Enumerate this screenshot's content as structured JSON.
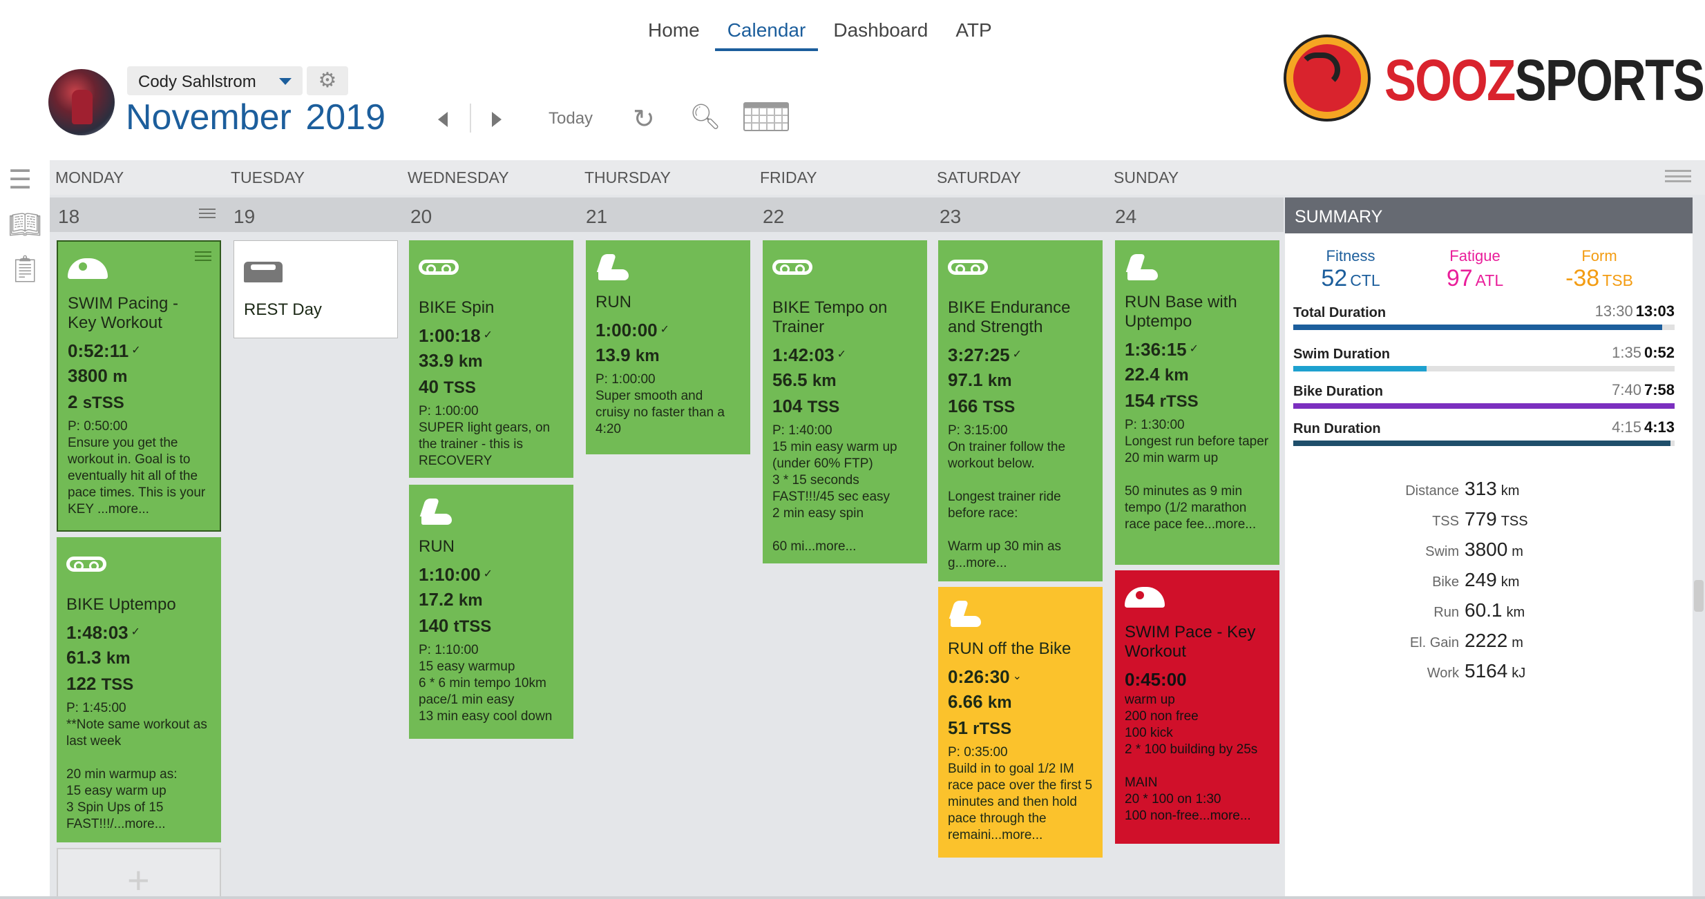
{
  "nav": {
    "tabs": [
      {
        "label": "Home"
      },
      {
        "label": "Calendar"
      },
      {
        "label": "Dashboard"
      },
      {
        "label": "ATP"
      }
    ],
    "active": "Calendar"
  },
  "header": {
    "user_name": "Cody Sahlstrom",
    "month": "November",
    "year": "2019",
    "today_label": "Today"
  },
  "logo": {
    "part1": "SOOZ",
    "part2": "SPORTS"
  },
  "colors": {
    "accent": "#1c5e9c",
    "completed": "#72bb55",
    "partial": "#fbc22c",
    "missed": "#d0102a",
    "fitness": "#1c5e9c",
    "fatigue": "#e91e9a",
    "form": "#f39c12"
  },
  "days": [
    "MONDAY",
    "TUESDAY",
    "WEDNESDAY",
    "THURSDAY",
    "FRIDAY",
    "SATURDAY",
    "SUNDAY"
  ],
  "dates": [
    "18",
    "19",
    "20",
    "21",
    "22",
    "23",
    "24"
  ],
  "workouts": {
    "mon1": {
      "title": "SWIM Pacing - Key Workout",
      "time": "0:52:11",
      "dist": "3800",
      "dist_unit": "m",
      "tss": "2",
      "tss_unit": "sTSS",
      "planned": "P: 0:50:00",
      "desc": "Ensure you get the workout in. Goal is to eventually hit all of the pace times. This is your KEY ...more..."
    },
    "mon2": {
      "title": "BIKE Uptempo",
      "time": "1:48:03",
      "dist": "61.3",
      "dist_unit": "km",
      "tss": "122",
      "tss_unit": "TSS",
      "planned": "P: 1:45:00",
      "desc": "**Note same workout as last week\n\n20 min warmup as:\n15 easy warm up\n3 Spin Ups of 15 FAST!!!/...more..."
    },
    "tue1": {
      "title": "REST Day"
    },
    "wed1": {
      "title": "BIKE Spin",
      "time": "1:00:18",
      "dist": "33.9",
      "dist_unit": "km",
      "tss": "40",
      "tss_unit": "TSS",
      "planned": "P: 1:00:00",
      "desc": "SUPER light gears, on the trainer - this is RECOVERY"
    },
    "wed2": {
      "title": "RUN",
      "time": "1:10:00",
      "dist": "17.2",
      "dist_unit": "km",
      "tss": "140",
      "tss_unit": "tTSS",
      "planned": "P: 1:10:00",
      "desc": "15 easy warmup\n6 * 6 min tempo 10km pace/1 min easy\n13 min easy cool down"
    },
    "thu1": {
      "title": "RUN",
      "time": "1:00:00",
      "dist": "13.9",
      "dist_unit": "km",
      "planned": "P: 1:00:00",
      "desc": "Super smooth and cruisy no faster than a 4:20"
    },
    "fri1": {
      "title": "BIKE Tempo on Trainer",
      "time": "1:42:03",
      "dist": "56.5",
      "dist_unit": "km",
      "tss": "104",
      "tss_unit": "TSS",
      "planned": "P: 1:40:00",
      "desc": "15 min easy warm up (under 60% FTP)\n3 * 15 seconds FAST!!!/45 sec easy\n2 min easy spin\n\n60 mi...more..."
    },
    "sat1": {
      "title": "BIKE Endurance and Strength",
      "time": "3:27:25",
      "dist": "97.1",
      "dist_unit": "km",
      "tss": "166",
      "tss_unit": "TSS",
      "planned": "P: 3:15:00",
      "desc": "On trainer follow the workout below.\n\nLongest trainer ride before race:\n\nWarm up 30 min as g...more..."
    },
    "sat2": {
      "title": "RUN off the Bike",
      "time": "0:26:30",
      "dist": "6.66",
      "dist_unit": "km",
      "tss": "51",
      "tss_unit": "rTSS",
      "planned": "P: 0:35:00",
      "desc": "Build in to goal 1/2 IM race pace over the first 5 minutes and then hold pace through the remaini...more..."
    },
    "sun1": {
      "title": "RUN Base with Uptempo",
      "time": "1:36:15",
      "dist": "22.4",
      "dist_unit": "km",
      "tss": "154",
      "tss_unit": "rTSS",
      "planned": "P: 1:30:00",
      "desc": "Longest run before taper\n20 min warm up\n\n50 minutes as 9 min tempo (1/2 marathon race pace fee...more..."
    },
    "sun2": {
      "title": "SWIM Pace - Key Workout",
      "time": "0:45:00",
      "desc": "warm up\n200 non free\n100 kick\n2 * 100 building by 25s\n\nMAIN\n20 * 100 on 1:30\n100 non-free...more..."
    }
  },
  "summary": {
    "title": "SUMMARY",
    "fitness": {
      "label": "Fitness",
      "value": "52",
      "unit": "CTL"
    },
    "fatigue": {
      "label": "Fatigue",
      "value": "97",
      "unit": "ATL"
    },
    "form": {
      "label": "Form",
      "value": "-38",
      "unit": "TSB"
    },
    "durations": [
      {
        "label": "Total Duration",
        "planned": "13:30",
        "actual": "13:03",
        "fill": 0.967,
        "color": "#1c5e9c"
      },
      {
        "label": "Swim Duration",
        "planned": "1:35",
        "actual": "0:52",
        "fill": 0.35,
        "color": "#1ea1cf"
      },
      {
        "label": "Bike Duration",
        "planned": "7:40",
        "actual": "7:58",
        "fill": 1.0,
        "color": "#7b2fbf"
      },
      {
        "label": "Run Duration",
        "planned": "4:15",
        "actual": "4:13",
        "fill": 0.99,
        "color": "#1f4f6b"
      }
    ],
    "totals": [
      {
        "label": "Distance",
        "value": "313",
        "unit": "km"
      },
      {
        "label": "TSS",
        "value": "779",
        "unit": "TSS"
      },
      {
        "label": "Swim",
        "value": "3800",
        "unit": "m"
      },
      {
        "label": "Bike",
        "value": "249",
        "unit": "km"
      },
      {
        "label": "Run",
        "value": "60.1",
        "unit": "km"
      },
      {
        "label": "El. Gain",
        "value": "2222",
        "unit": "m"
      },
      {
        "label": "Work",
        "value": "5164",
        "unit": "kJ"
      }
    ]
  }
}
